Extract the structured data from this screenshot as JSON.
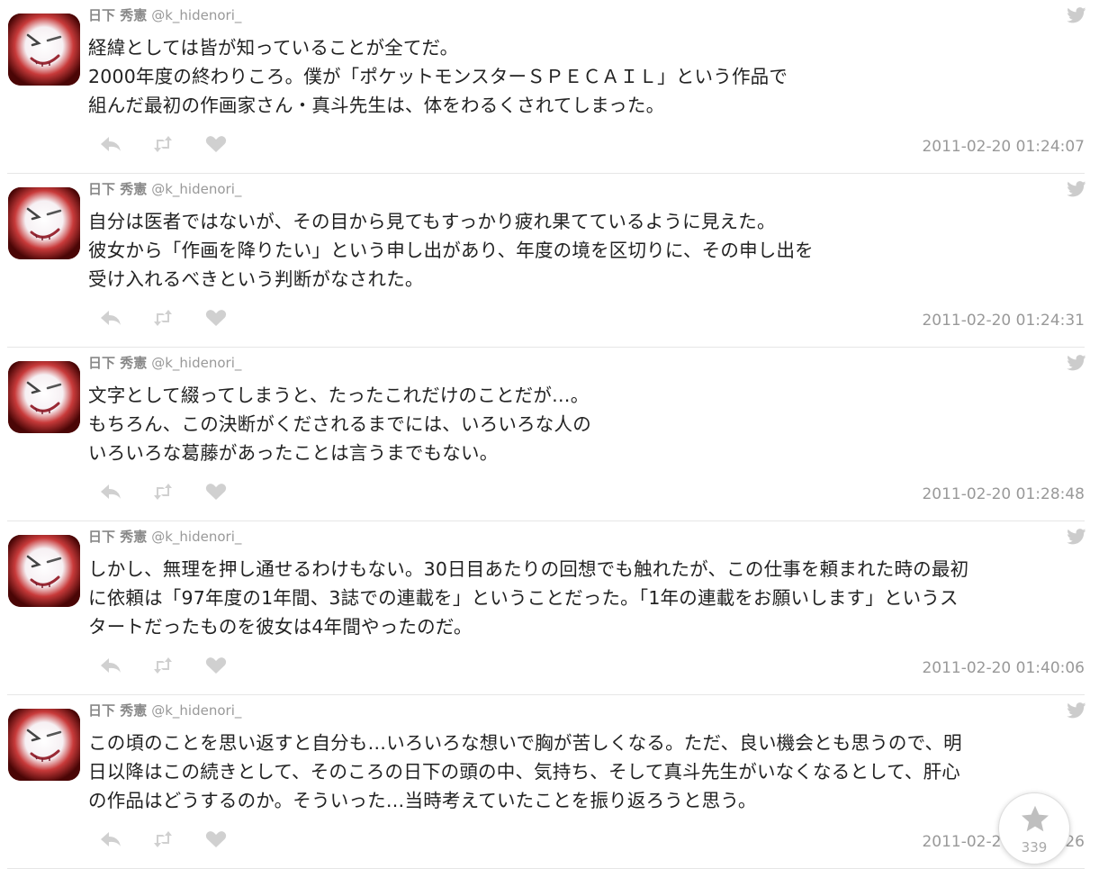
{
  "colors": {
    "meta_gray": "#999999",
    "icon_gray": "#cccccc",
    "text": "#222222"
  },
  "tweets": [
    {
      "name": "日下 秀憲",
      "handle": "@k_hidenori_",
      "text": "経緯としては皆が知っていることが全てだ。\n2000年度の終わりころ。僕が「ポケットモンスターＳＰＥＣＡＩＬ」という作品で\n組んだ最初の作画家さん・真斗先生は、体をわるくされてしまった。",
      "time": "2011-02-20 01:24:07"
    },
    {
      "name": "日下 秀憲",
      "handle": "@k_hidenori_",
      "text": "自分は医者ではないが、その目から見てもすっかり疲れ果てているように見えた。\n彼女から「作画を降りたい」という申し出があり、年度の境を区切りに、その申し出を\n受け入れるべきという判断がなされた。",
      "time": "2011-02-20 01:24:31"
    },
    {
      "name": "日下 秀憲",
      "handle": "@k_hidenori_",
      "text": "文字として綴ってしまうと、たったこれだけのことだが…。\nもちろん、この決断がくだされるまでには、いろいろな人の\nいろいろな葛藤があったことは言うまでもない。",
      "time": "2011-02-20 01:28:48"
    },
    {
      "name": "日下 秀憲",
      "handle": "@k_hidenori_",
      "text": "しかし、無理を押し通せるわけもない。30日目あたりの回想でも触れたが、この仕事を頼まれた時の最初\nに依頼は「97年度の1年間、3誌での連載を」ということだった。「1年の連載をお願いします」というス\nタートだったものを彼女は4年間やったのだ。",
      "time": "2011-02-20 01:40:06"
    },
    {
      "name": "日下 秀憲",
      "handle": "@k_hidenori_",
      "text": "この頃のことを思い返すと自分も…いろいろな想いで胸が苦しくなる。ただ、良い機会とも思うので、明\n日以降はこの続きとして、そのころの日下の頭の中、気持ち、そして真斗先生がいなくなるとして、肝心\nの作品はどうするのか。そういった…当時考えていたことを振り返ろうと思う。",
      "time": "2011-02-20 01:42:26"
    }
  ],
  "icons": {
    "avatar": "avatar-image",
    "bird": "twitter-bird-icon",
    "reply": "reply-icon",
    "retweet": "retweet-icon",
    "like": "heart-icon",
    "favorite": "star-icon"
  },
  "favorite_widget": {
    "count": "339"
  }
}
